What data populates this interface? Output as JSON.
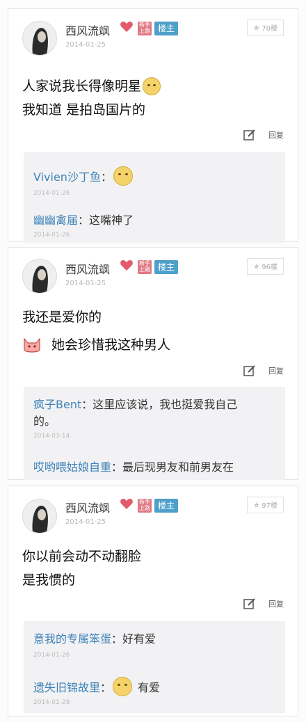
{
  "posts": [
    {
      "username": "西风流飒",
      "badge_red": "新手上路",
      "badge_owner": "楼主",
      "date": "2014-01-25",
      "floor": "70楼",
      "lines": [
        "人家说我长得像明星",
        "我知道 是拍岛国片的"
      ],
      "reply_label": "回复",
      "comments": [
        {
          "name": "Vivien沙丁鱼",
          "sep": "：",
          "text": "",
          "date": "2014-01-26"
        },
        {
          "name": "幽幽禽届",
          "sep": "：",
          "text": "这嘴神了",
          "date": "2014-01-26"
        }
      ]
    },
    {
      "username": "西风流飒",
      "badge_red": "新手上路",
      "badge_owner": "楼主",
      "date": "2014-01-25",
      "floor": "96楼",
      "lines": [
        "我还是爱你的",
        "她会珍惜我这种男人"
      ],
      "reply_label": "回复",
      "comments": [
        {
          "name": "疯子Bent",
          "sep": "：",
          "text": "这里应该说，我也挺爱我自己",
          "text2": "的。",
          "date": "2014-03-14"
        },
        {
          "name": "哎哟喂姑娘自重",
          "sep": "：",
          "text": "最后现男友和前男友在",
          "date": ""
        }
      ]
    },
    {
      "username": "西风流飒",
      "badge_red": "新手上路",
      "badge_owner": "楼主",
      "date": "2014-01-25",
      "floor": "97楼",
      "lines": [
        "你以前会动不动翻脸",
        "是我惯的"
      ],
      "reply_label": "回复",
      "comments": [
        {
          "name": "意我的专属笨蛋",
          "sep": "：",
          "text": "好有爱",
          "date": "2014-01-26"
        },
        {
          "name": "遗失旧锦故里",
          "sep": "：",
          "text": "有爱",
          "date": "2014-01-28"
        }
      ]
    }
  ],
  "icons": {
    "heart": "heart-icon",
    "edit": "edit-icon",
    "star": "star-icon",
    "emoji": "smile-emoji-icon",
    "cat": "cat-emoji-icon"
  },
  "colors": {
    "comment_name": "#3d82b8",
    "owner_badge": "#4da0c9",
    "red_badge": "#e07a84",
    "comment_bg": "#f2f2f4"
  }
}
